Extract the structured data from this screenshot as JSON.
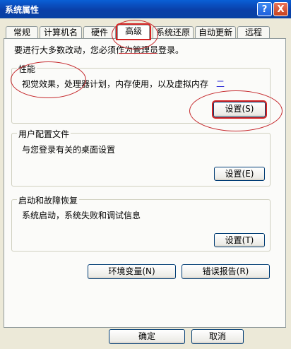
{
  "window": {
    "title": "系统属性",
    "help_label": "?",
    "close_label": "X"
  },
  "tabs": [
    "常规",
    "计算机名",
    "硬件",
    "高级",
    "系统还原",
    "自动更新",
    "远程"
  ],
  "notice": "要进行大多数改动，您必须作为管理员登录。",
  "performance": {
    "title": "性能",
    "description": "视觉效果，处理器计划，内存使用，以及虚拟内存",
    "settings_label": "设置(S)"
  },
  "user_profiles": {
    "title": "用户配置文件",
    "description": "与您登录有关的桌面设置",
    "settings_label": "设置(E)"
  },
  "startup_recovery": {
    "title": "启动和故障恢复",
    "description": "系统启动，系统失败和调试信息",
    "settings_label": "设置(T)"
  },
  "buttons": {
    "env_vars": "环境变量(N)",
    "error_report": "错误报告(R)",
    "ok": "确定",
    "cancel": "取消"
  },
  "annotation_mark": "二",
  "colors": {
    "title_bar": "#0a4fc6",
    "annotation_red": "#c5282c"
  }
}
